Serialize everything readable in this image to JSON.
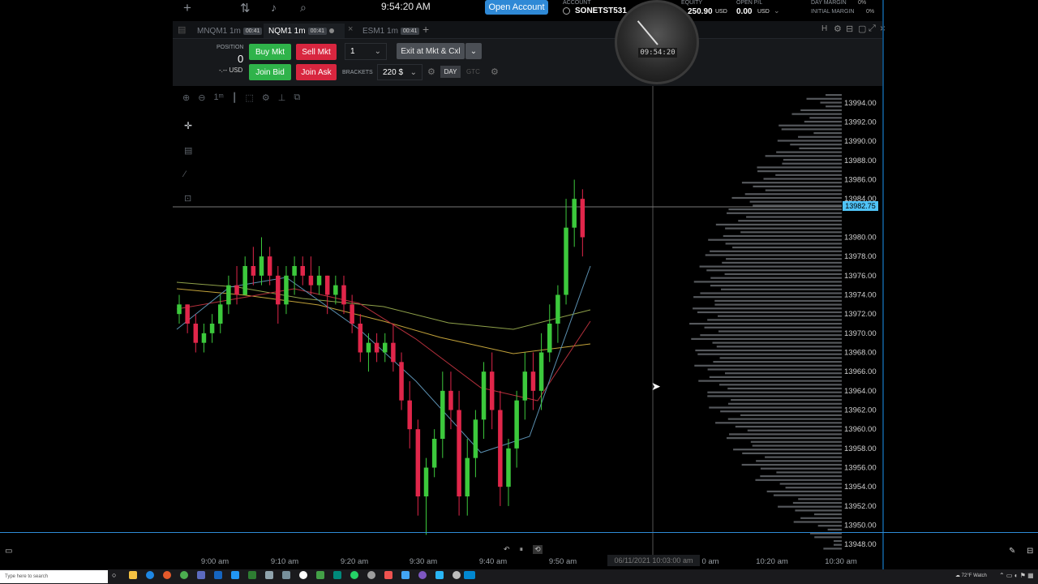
{
  "topbar": {
    "time": "9:54:20 AM",
    "open_account": "Open Account",
    "account_label": "ACCOUNT",
    "account_name": "SONETST531",
    "equity_label": "EQUITY",
    "equity_value": "250.90",
    "equity_unit": "USD",
    "open_pl_label": "OPEN P/L",
    "open_pl_value": "0.00",
    "open_pl_unit": "USD",
    "day_margin_label": "DAY MARGIN",
    "day_margin_value": "0%",
    "initial_margin_label": "INITIAL MARGIN",
    "initial_margin_value": "0%",
    "icons": [
      "plus-icon",
      "transfer-icon",
      "bell-icon",
      "search-icon"
    ]
  },
  "tabs": [
    {
      "label": "MNQM1 1m",
      "badge": "00:41",
      "active": false
    },
    {
      "label": "NQM1 1m",
      "badge": "00:41",
      "active": true
    },
    {
      "label": "ESM1 1m",
      "badge": "00:41",
      "active": false
    }
  ],
  "order_panel": {
    "position_label": "POSITION",
    "position_value": "0",
    "position_currency": "-.-- USD",
    "buy_mkt": "Buy Mkt",
    "sell_mkt": "Sell Mkt",
    "join_bid": "Join Bid",
    "join_ask": "Join Ask",
    "quantity": "1",
    "exit_label": "Exit at Mkt & Cxl",
    "brackets_label": "BRACKETS",
    "brackets_value": "220 $",
    "day": "DAY",
    "gtc": "GTC"
  },
  "widget_clock": {
    "time": "09:54:20"
  },
  "chart": {
    "current_price": "13982.75",
    "y_ticks": [
      "13994.00",
      "13992.00",
      "13990.00",
      "13988.00",
      "13986.00",
      "13984.00",
      "13980.00",
      "13978.00",
      "13976.00",
      "13974.00",
      "13972.00",
      "13970.00",
      "13968.00",
      "13966.00",
      "13964.00",
      "13962.00",
      "13960.00",
      "13958.00",
      "13956.00",
      "13954.00",
      "13952.00",
      "13950.00",
      "13948.00"
    ],
    "x_ticks": [
      "9:00 am",
      "9:10 am",
      "9:20 am",
      "9:30 am",
      "9:40 am",
      "9:50 am",
      "0 am",
      "10:20 am",
      "10:30 am"
    ],
    "crosshair_date": "06/11/2021 10:03:00 am",
    "colors": {
      "up": "#3cc93c",
      "down": "#e0264a",
      "volume": "#9aa0a8",
      "price_tag": "#4fc3f7"
    }
  },
  "chart_data": {
    "type": "candlestick",
    "ylim": [
      13947,
      13995
    ],
    "candles": [
      [
        13972,
        13974,
        13971,
        13973
      ],
      [
        13973,
        13973,
        13970,
        13971
      ],
      [
        13971,
        13972,
        13968,
        13969
      ],
      [
        13969,
        13971,
        13968,
        13970
      ],
      [
        13970,
        13972,
        13969,
        13971
      ],
      [
        13971,
        13974,
        13970,
        13973
      ],
      [
        13973,
        13976,
        13972,
        13975
      ],
      [
        13975,
        13977,
        13973,
        13974
      ],
      [
        13974,
        13978,
        13974,
        13977
      ],
      [
        13977,
        13979,
        13975,
        13976
      ],
      [
        13976,
        13980,
        13975,
        13978
      ],
      [
        13978,
        13979,
        13975,
        13976
      ],
      [
        13976,
        13977,
        13971,
        13973
      ],
      [
        13973,
        13977,
        13972,
        13976
      ],
      [
        13976,
        13978,
        13974,
        13977
      ],
      [
        13977,
        13978,
        13975,
        13976
      ],
      [
        13976,
        13978,
        13974,
        13975
      ],
      [
        13975,
        13977,
        13974,
        13976
      ],
      [
        13976,
        13976,
        13972,
        13974
      ],
      [
        13974,
        13976,
        13973,
        13975
      ],
      [
        13975,
        13976,
        13972,
        13973
      ],
      [
        13973,
        13974,
        13970,
        13971
      ],
      [
        13971,
        13972,
        13967,
        13968
      ],
      [
        13968,
        13970,
        13966,
        13969
      ],
      [
        13969,
        13970,
        13967,
        13968
      ],
      [
        13968,
        13970,
        13967,
        13969
      ],
      [
        13969,
        13971,
        13966,
        13967
      ],
      [
        13967,
        13968,
        13962,
        13963
      ],
      [
        13963,
        13965,
        13958,
        13960
      ],
      [
        13960,
        13961,
        13951,
        13953
      ],
      [
        13953,
        13957,
        13949,
        13956
      ],
      [
        13956,
        13960,
        13955,
        13959
      ],
      [
        13959,
        13966,
        13957,
        13964
      ],
      [
        13964,
        13966,
        13960,
        13962
      ],
      [
        13962,
        13964,
        13951,
        13953
      ],
      [
        13953,
        13959,
        13951,
        13957
      ],
      [
        13957,
        13962,
        13955,
        13961
      ],
      [
        13961,
        13967,
        13959,
        13966
      ],
      [
        13966,
        13968,
        13960,
        13962
      ],
      [
        13962,
        13964,
        13952,
        13954
      ],
      [
        13954,
        13959,
        13952,
        13958
      ],
      [
        13958,
        13964,
        13956,
        13963
      ],
      [
        13963,
        13968,
        13961,
        13966
      ],
      [
        13966,
        13968,
        13962,
        13964
      ],
      [
        13964,
        13970,
        13962,
        13968
      ],
      [
        13968,
        13973,
        13967,
        13971
      ],
      [
        13971,
        13975,
        13969,
        13974
      ],
      [
        13974,
        13984,
        13973,
        13981
      ],
      [
        13981,
        13986,
        13979,
        13984
      ],
      [
        13984,
        13985,
        13978,
        13980
      ]
    ]
  }
}
